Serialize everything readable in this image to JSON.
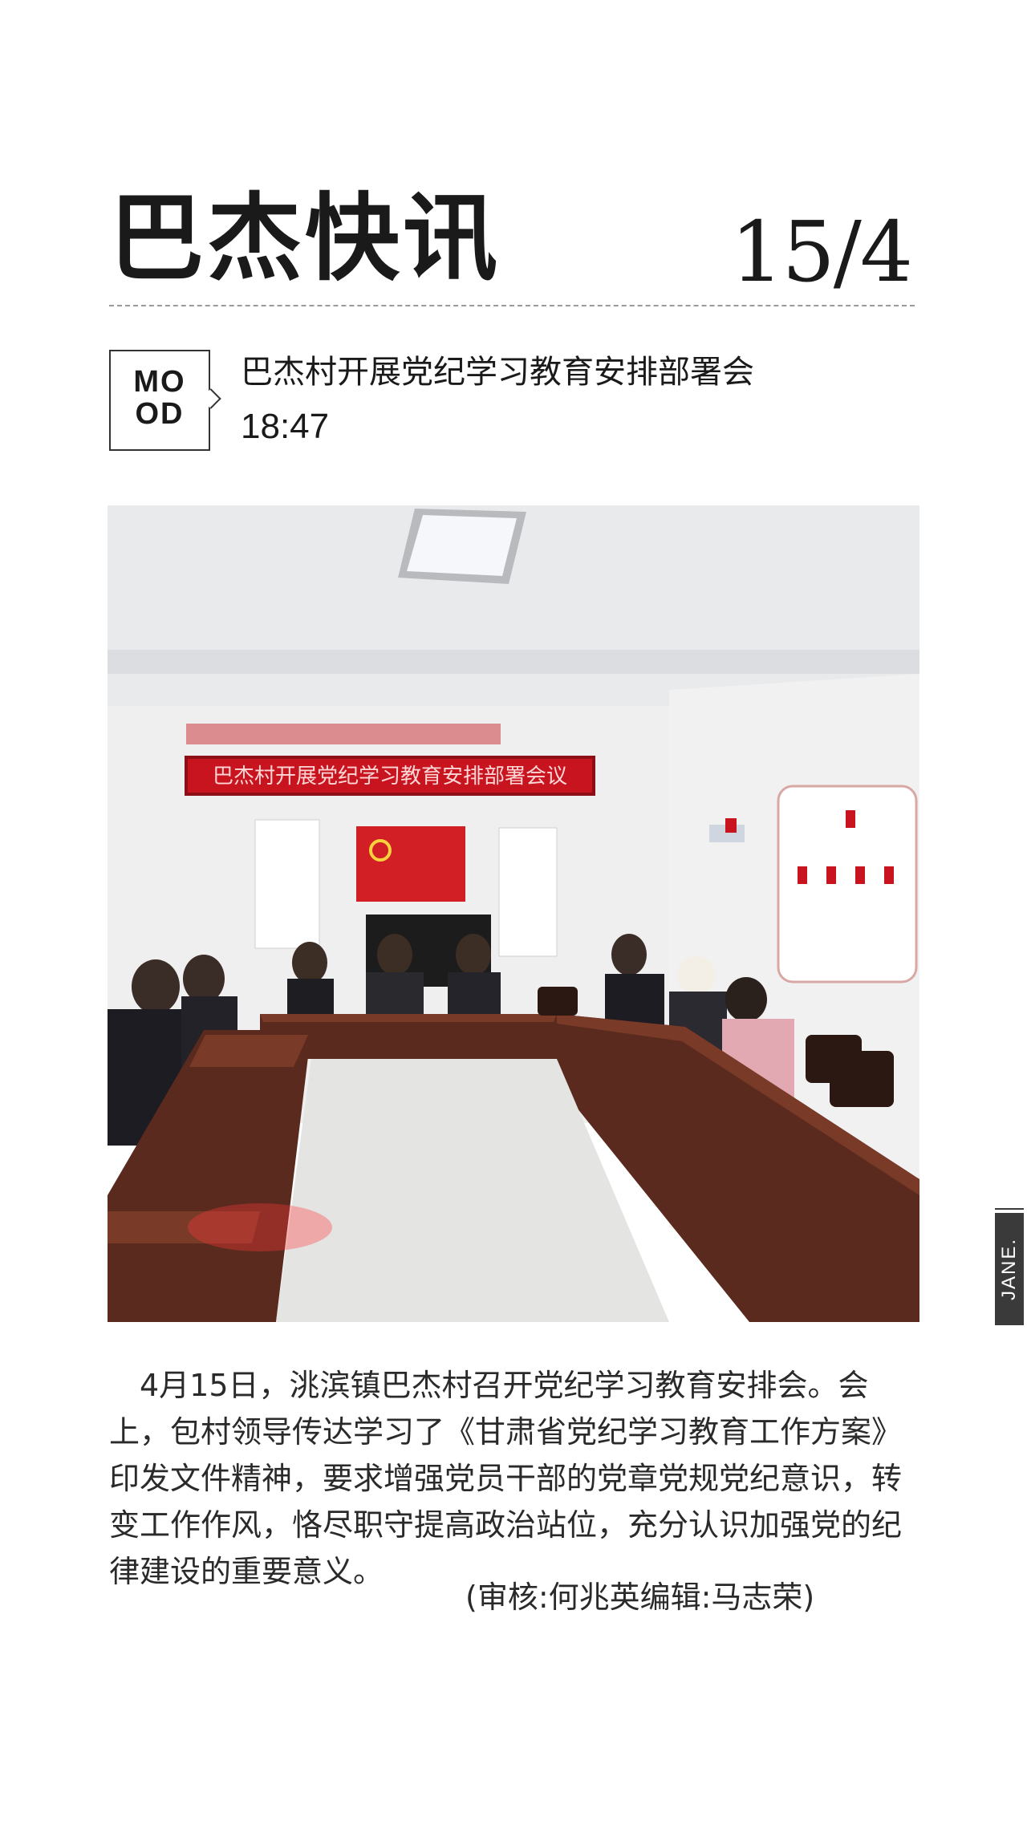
{
  "header": {
    "title": "巴杰快讯",
    "date": "15/4"
  },
  "mood_label": "MO\nOD",
  "article": {
    "title": "巴杰村开展党纪学习教育安排部署会",
    "time": "18:47",
    "banner_text": "巴杰村开展党纪学习教育安排部署会议",
    "paragraph": "4月15日，洮滨镇巴杰村召开党纪学习教育安排会。会上，包村领导传达学习了《甘肃省党纪学习教育工作方案》印发文件精神，要求增强党员干部的党章党规党纪意识，转变工作作风，恪尽职守提高政治站位，充分认识加强党的纪律建设的重要意义。",
    "credits": "(审核:何兆英编辑:马志荣)"
  },
  "side_tag": "JANE.",
  "colors": {
    "text": "#1a1a1a",
    "banner_red": "#c8141e",
    "flag_red": "#d21f26",
    "table_brown": "#5a2a1e"
  }
}
